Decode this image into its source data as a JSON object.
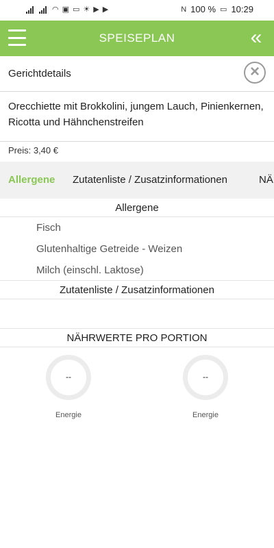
{
  "status_bar": {
    "battery_percent": "100 %",
    "time": "10:29"
  },
  "header": {
    "title": "SPEISEPLAN"
  },
  "detail": {
    "heading": "Gerichtdetails",
    "dish_name": "Orecchiette mit Brokkolini, jungem Lauch, Pinienkernen, Ricotta und Hähnchenstreifen",
    "price": "Preis: 3,40 €"
  },
  "tabs": [
    {
      "label": "Allergene",
      "active": true
    },
    {
      "label": "Zutatenliste / Zusatzinformationen",
      "active": false
    },
    {
      "label": "NÄ",
      "active": false
    }
  ],
  "allergens": {
    "title": "Allergene",
    "items": [
      "Fisch",
      "Glutenhaltige Getreide - Weizen",
      "Milch (einschl. Laktose)"
    ]
  },
  "ingredients": {
    "title": "Zutatenliste / Zusatzinformationen"
  },
  "nutrition": {
    "title": "NÄHRWERTE PRO PORTION",
    "items": [
      {
        "value": "--",
        "label": "Energie"
      },
      {
        "value": "--",
        "label": "Energie"
      }
    ]
  },
  "colors": {
    "brand_green": "#8ac754",
    "tab_background": "#f1f1f1"
  }
}
